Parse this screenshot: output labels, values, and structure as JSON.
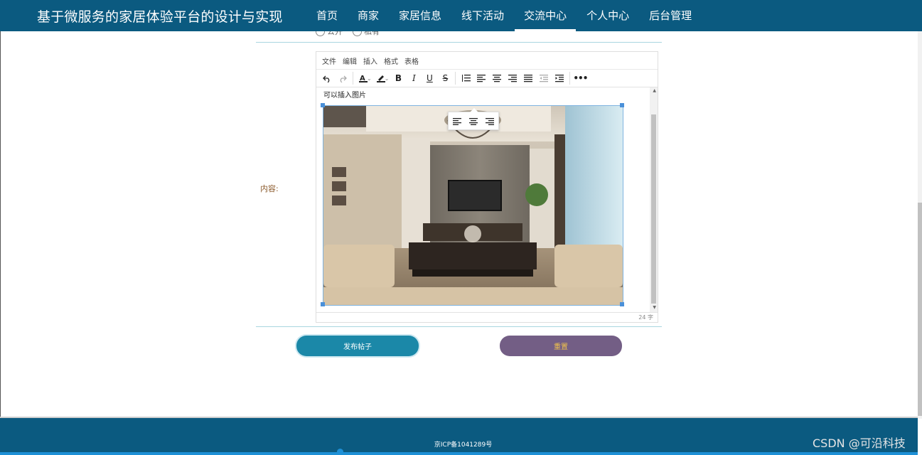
{
  "header": {
    "site_title": "基于微服务的家居体验平台的设计与实现",
    "nav": [
      {
        "label": "首页"
      },
      {
        "label": "商家"
      },
      {
        "label": "家居信息"
      },
      {
        "label": "线下活动"
      },
      {
        "label": "交流中心",
        "active": true
      },
      {
        "label": "个人中心"
      },
      {
        "label": "后台管理"
      }
    ]
  },
  "form": {
    "radio_options": [
      "公开",
      "私有"
    ],
    "content_label": "内容:",
    "editor": {
      "menus": [
        "文件",
        "编辑",
        "插入",
        "格式",
        "表格"
      ],
      "placeholder_text": "可以插入图片",
      "word_count": "24 字",
      "image_alt": "living-room-photo"
    },
    "submit_label": "发布帖子",
    "reset_label": "重置"
  },
  "footer": {
    "icp": "京ICP备1041289号"
  },
  "watermark": "CSDN @可沿科技",
  "colors": {
    "header_bg": "#0b5a80",
    "submit_bg": "#1b88a8",
    "reset_bg": "#735e85",
    "reset_text": "#f0c24a",
    "label": "#8b5a2b"
  }
}
